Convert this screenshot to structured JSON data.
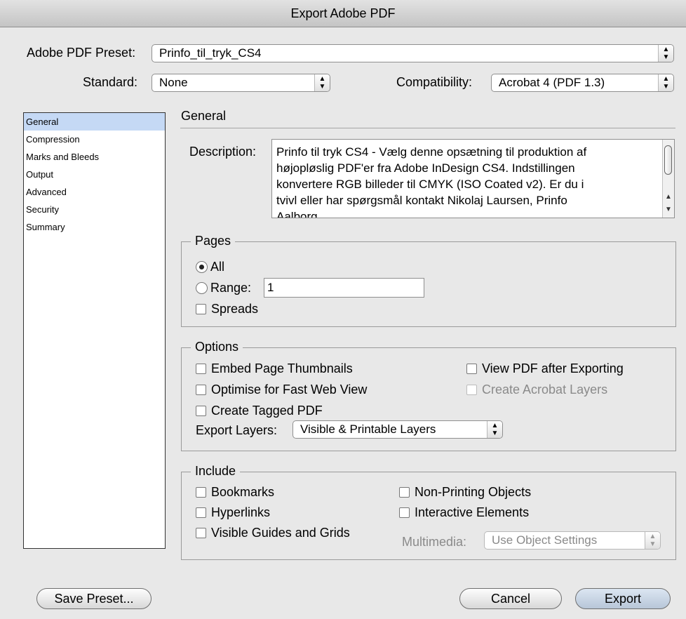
{
  "window": {
    "title": "Export Adobe PDF"
  },
  "preset": {
    "label": "Adobe PDF Preset:",
    "value": "Prinfo_til_tryk_CS4"
  },
  "standard": {
    "label": "Standard:",
    "value": "None"
  },
  "compatibility": {
    "label": "Compatibility:",
    "value": "Acrobat 4 (PDF 1.3)"
  },
  "sidebar": {
    "items": [
      {
        "label": "General",
        "selected": true
      },
      {
        "label": "Compression"
      },
      {
        "label": "Marks and Bleeds"
      },
      {
        "label": "Output"
      },
      {
        "label": "Advanced"
      },
      {
        "label": "Security"
      },
      {
        "label": "Summary"
      }
    ]
  },
  "general": {
    "title": "General",
    "description_label": "Description:",
    "description_lines": [
      "Prinfo til tryk CS4 - Vælg denne opsætning til produktion af",
      "højopløslig PDF'er fra Adobe InDesign CS4. Indstillingen",
      "konvertere RGB billeder til CMYK (ISO Coated v2). Er du i",
      "tvivl eller har spørgsmål kontakt Nikolaj Laursen, Prinfo",
      "Aalborg"
    ]
  },
  "pages": {
    "title": "Pages",
    "all_label": "All",
    "range_label": "Range:",
    "range_value": "1",
    "spreads_label": "Spreads",
    "selected": "All"
  },
  "options": {
    "title": "Options",
    "embed_thumbnails": "Embed Page Thumbnails",
    "optimise_web": "Optimise for Fast Web View",
    "tagged_pdf": "Create Tagged PDF",
    "view_after": "View PDF after Exporting",
    "acrobat_layers": "Create Acrobat Layers",
    "export_layers_label": "Export Layers:",
    "export_layers_value": "Visible & Printable Layers"
  },
  "include": {
    "title": "Include",
    "bookmarks": "Bookmarks",
    "hyperlinks": "Hyperlinks",
    "guides_grids": "Visible Guides and Grids",
    "non_printing": "Non-Printing Objects",
    "interactive": "Interactive Elements",
    "multimedia_label": "Multimedia:",
    "multimedia_value": "Use Object Settings"
  },
  "buttons": {
    "save_preset": "Save Preset...",
    "cancel": "Cancel",
    "export": "Export"
  }
}
